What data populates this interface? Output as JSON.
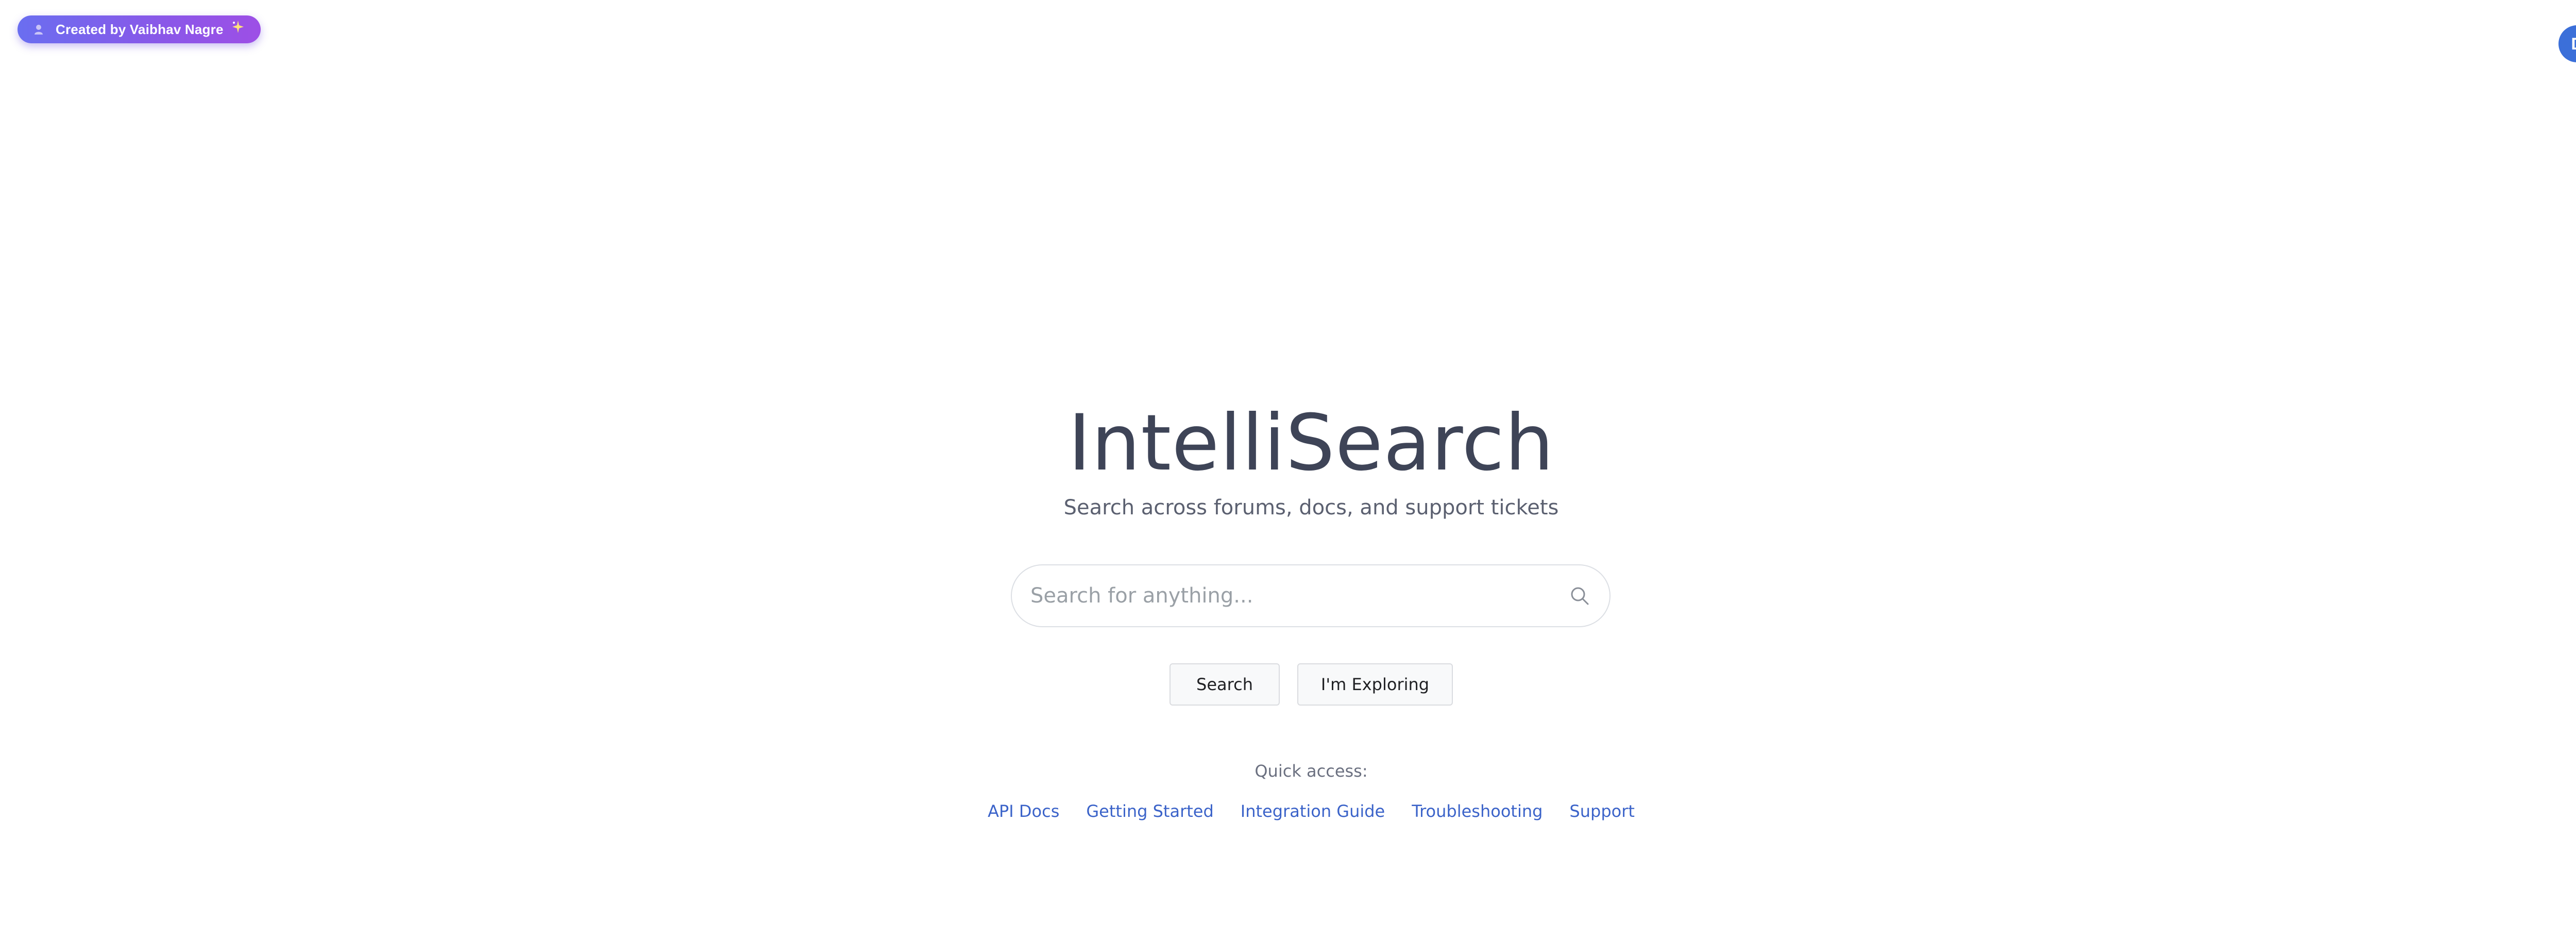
{
  "badge": {
    "text": "Created by Vaibhav Nagre",
    "icon": "person-icon",
    "sparkle_icon": "sparkle-icon"
  },
  "header": {
    "avatar_initial": "D"
  },
  "hero": {
    "title": "IntelliSearch",
    "tagline": "Search across forums, docs, and support tickets"
  },
  "search": {
    "placeholder": "Search for anything...",
    "value": "",
    "icon": "search-icon"
  },
  "actions": {
    "search_label": "Search",
    "explore_label": "I'm Exploring"
  },
  "quick_access": {
    "label": "Quick access:",
    "links": [
      {
        "label": "API Docs"
      },
      {
        "label": "Getting Started"
      },
      {
        "label": "Integration Guide"
      },
      {
        "label": "Troubleshooting"
      },
      {
        "label": "Support"
      }
    ]
  },
  "colors": {
    "badge_gradient_start": "#6a6ef0",
    "badge_gradient_end": "#9d4fe6",
    "avatar_bg": "#3b6fd9",
    "title_color": "#3e4457",
    "link_color": "#3b63c9"
  }
}
